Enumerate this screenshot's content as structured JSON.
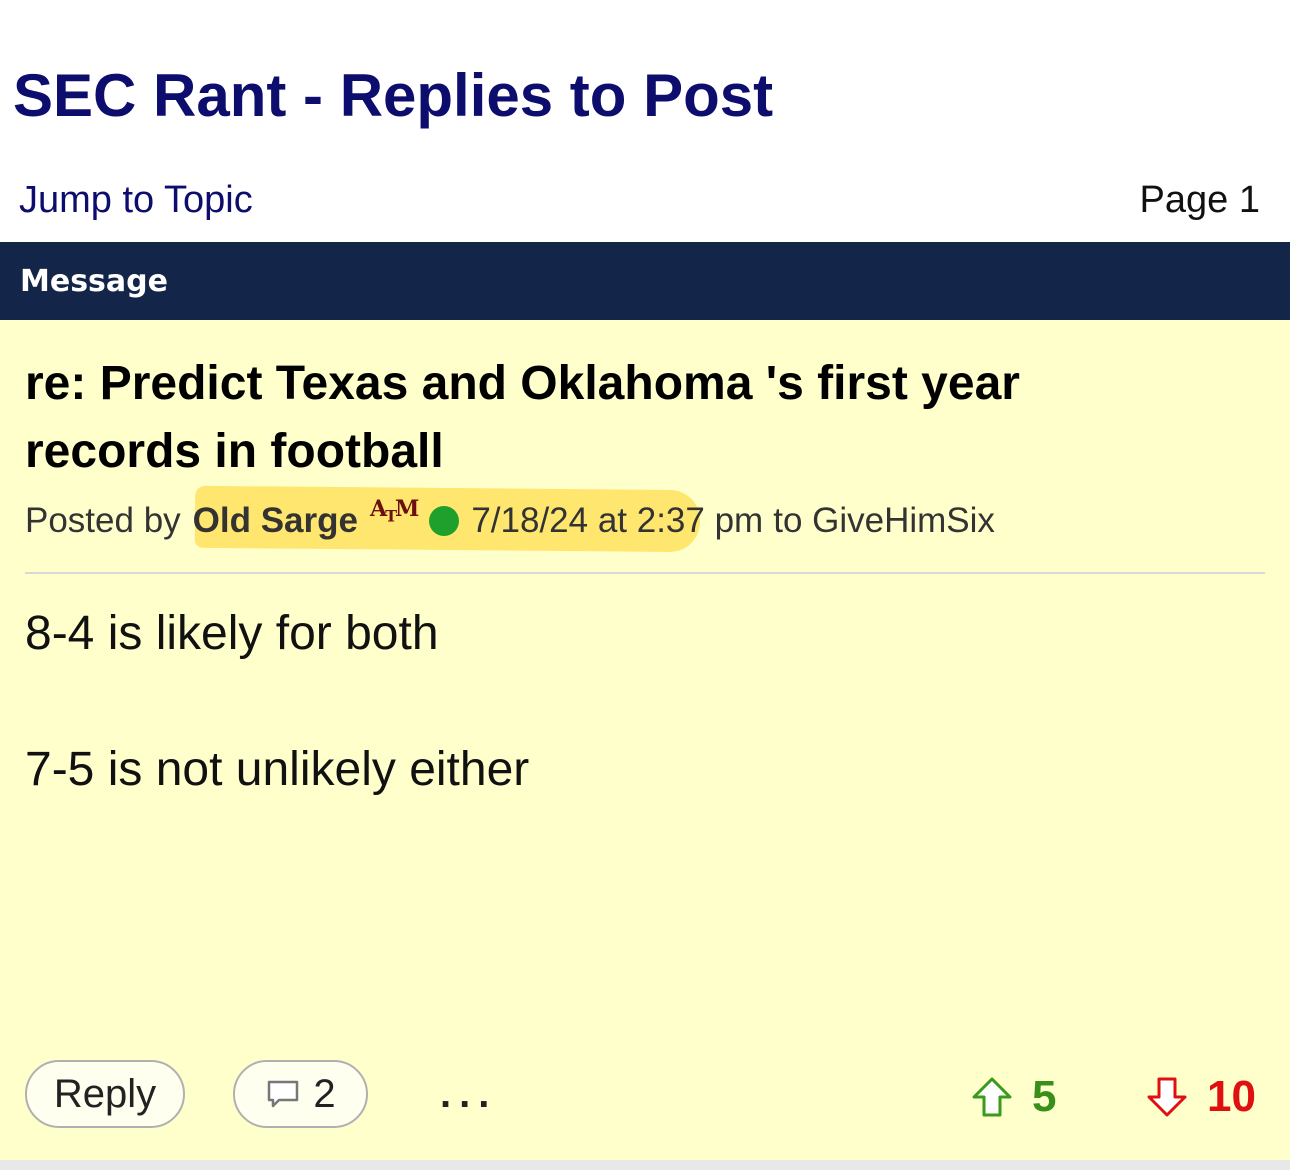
{
  "header": {
    "title": "SEC Rant - Replies to Post"
  },
  "nav": {
    "jump_label": "Jump to Topic",
    "page_label": "Page 1"
  },
  "table": {
    "column_header": "Message"
  },
  "post": {
    "title": "re: Predict Texas and Oklahoma 's first year records in football",
    "posted_by_label": "Posted by",
    "author": "Old Sarge",
    "team_logo_text": "ATM",
    "online_status_color": "#1fa02c",
    "date": "7/18/24 at 2:37 pm",
    "to_text": "to GiveHimSix",
    "body": [
      "8-4 is likely for both",
      "7-5 is not unlikely either"
    ]
  },
  "actions": {
    "reply_label": "Reply",
    "comment_count": "2",
    "more_label": "...",
    "upvotes": "5",
    "downvotes": "10"
  },
  "colors": {
    "title": "#0d0d6e",
    "header_bar": "#14254a",
    "post_bg": "#ffffcc",
    "upvote": "#3a8f1a",
    "downvote": "#e01010",
    "highlight": "#ffd93c"
  },
  "icons": {
    "comment": "speech-bubble-icon",
    "upvote": "arrow-up-icon",
    "downvote": "arrow-down-icon"
  }
}
